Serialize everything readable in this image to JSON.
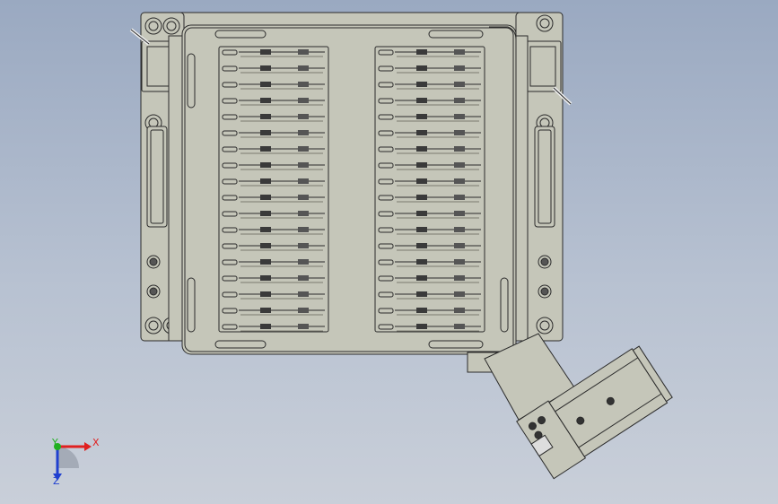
{
  "viewport": {
    "background_top": "#9aa9c1",
    "background_bottom": "#c9cfd9",
    "part_fill": "#c5c6b9",
    "part_stroke": "#2b2b2b"
  },
  "model": {
    "tray_left_row_count": 18,
    "tray_right_row_count": 18
  },
  "triad": {
    "x_label": "X",
    "y_label": "Y",
    "z_label": "Z",
    "x_color": "#e02020",
    "y_color": "#20b020",
    "z_color": "#2040d0"
  }
}
